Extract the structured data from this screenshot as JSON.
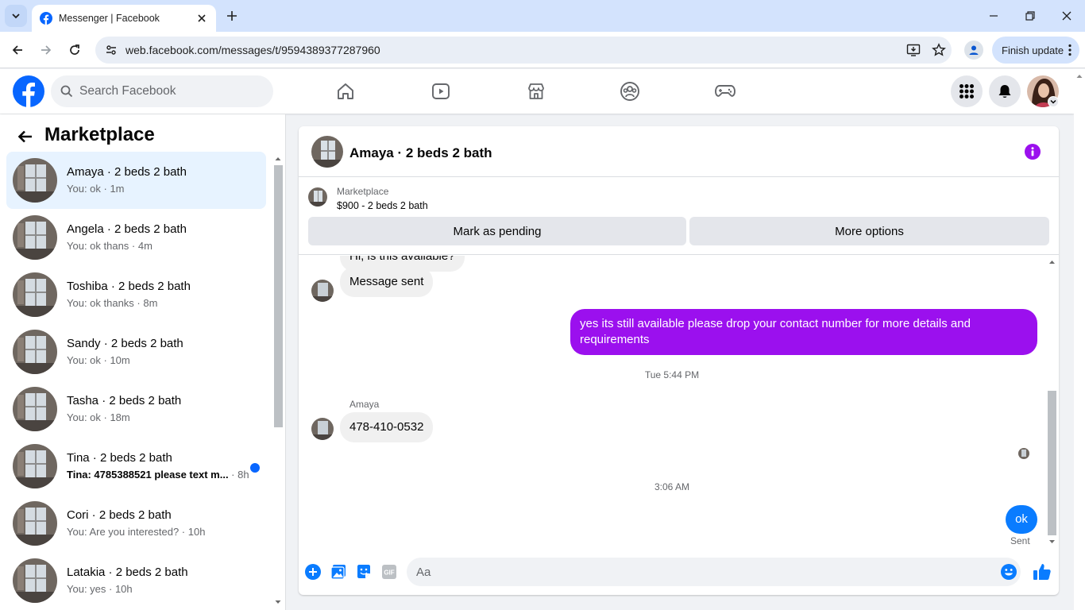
{
  "browser": {
    "tab_title": "Messenger | Facebook",
    "url": "web.facebook.com/messages/t/9594389377287960",
    "finish_update": "Finish update"
  },
  "facebook": {
    "search_placeholder": "Search Facebook"
  },
  "sidebar": {
    "title": "Marketplace",
    "conversations": [
      {
        "name": "Amaya · 2 beds 2 bath",
        "preview": "You: ok · 1m",
        "active": true
      },
      {
        "name": "Angela · 2 beds 2 bath",
        "preview": "You: ok thans · 4m"
      },
      {
        "name": "Toshiba · 2 beds 2 bath",
        "preview": "You: ok thanks · 8m"
      },
      {
        "name": "Sandy · 2 beds 2 bath",
        "preview": "You: ok · 10m"
      },
      {
        "name": "Tasha · 2 beds 2 bath",
        "preview": "You: ok · 18m"
      },
      {
        "name": "Tina · 2 beds 2 bath",
        "preview": "Tina: 4785388521 please text m...",
        "time": " · 8h",
        "unread": true
      },
      {
        "name": "Cori · 2 beds 2 bath",
        "preview": "You: Are you interested? · 10h"
      },
      {
        "name": "Latakia · 2 beds 2 bath",
        "preview": "You: yes · 10h"
      }
    ]
  },
  "chat": {
    "title": "Amaya · 2 beds 2 bath",
    "listing": {
      "source": "Marketplace",
      "price_title": "$900 - 2 beds 2 bath",
      "mark_pending": "Mark as pending",
      "more_options": "More options"
    },
    "messages": {
      "partial_top": "Hi, is this available?",
      "auto_sent": "Message sent",
      "reply": "yes its still available please drop your contact number for more details and requirements",
      "timestamp1": "Tue 5:44 PM",
      "sender": "Amaya",
      "phone": "478-410-0532",
      "timestamp2": "3:06 AM",
      "last_out": "ok",
      "status": "Sent"
    },
    "composer_placeholder": "Aa"
  },
  "colors": {
    "fb_blue": "#0866ff",
    "messenger_purple": "#9b10ee",
    "sent_blue": "#0a7cff"
  }
}
